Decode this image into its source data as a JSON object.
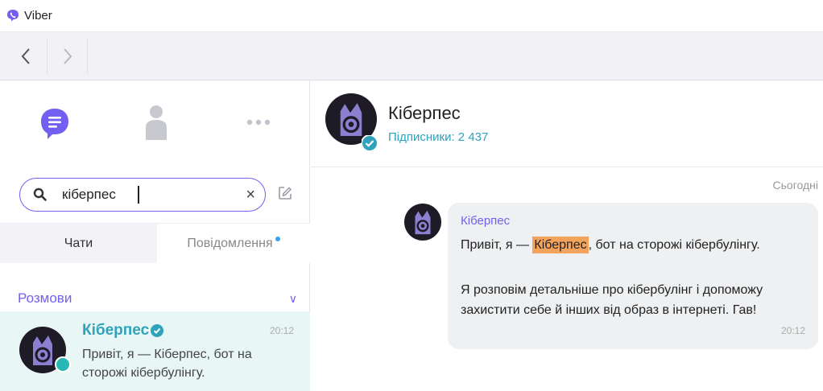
{
  "window": {
    "title": "Viber"
  },
  "sidebar": {
    "search": {
      "value": "кіберпес",
      "clear_glyph": "×"
    },
    "tabs": [
      {
        "label": "Чати"
      },
      {
        "label": "Повідомлення"
      }
    ],
    "section": {
      "label": "Розмови"
    },
    "chat_row": {
      "name": "Кіберпес",
      "time": "20:12",
      "preview": "Привіт, я — Кіберпес, бот на сторожі кібербулінгу."
    }
  },
  "chat": {
    "title": "Кіберпес",
    "subscribers": "Підписники: 2 437",
    "date_divider": "Сьогодні",
    "message": {
      "sender": "Кіберпес",
      "line1_before": "Привіт, я — ",
      "line1_highlight": "Кіберпес",
      "line1_after": ", бот на сторожі кібербулінгу.",
      "paragraph2": "Я розповім детальніше про кібербулінг і допоможу захистити себе й інших від образ в інтернеті. Гав!",
      "time": "20:12"
    }
  },
  "colors": {
    "accent": "#7360f2",
    "link": "#2fa3ba",
    "highlight": "#f3a35c",
    "selected_row": "#e9f6f6"
  }
}
